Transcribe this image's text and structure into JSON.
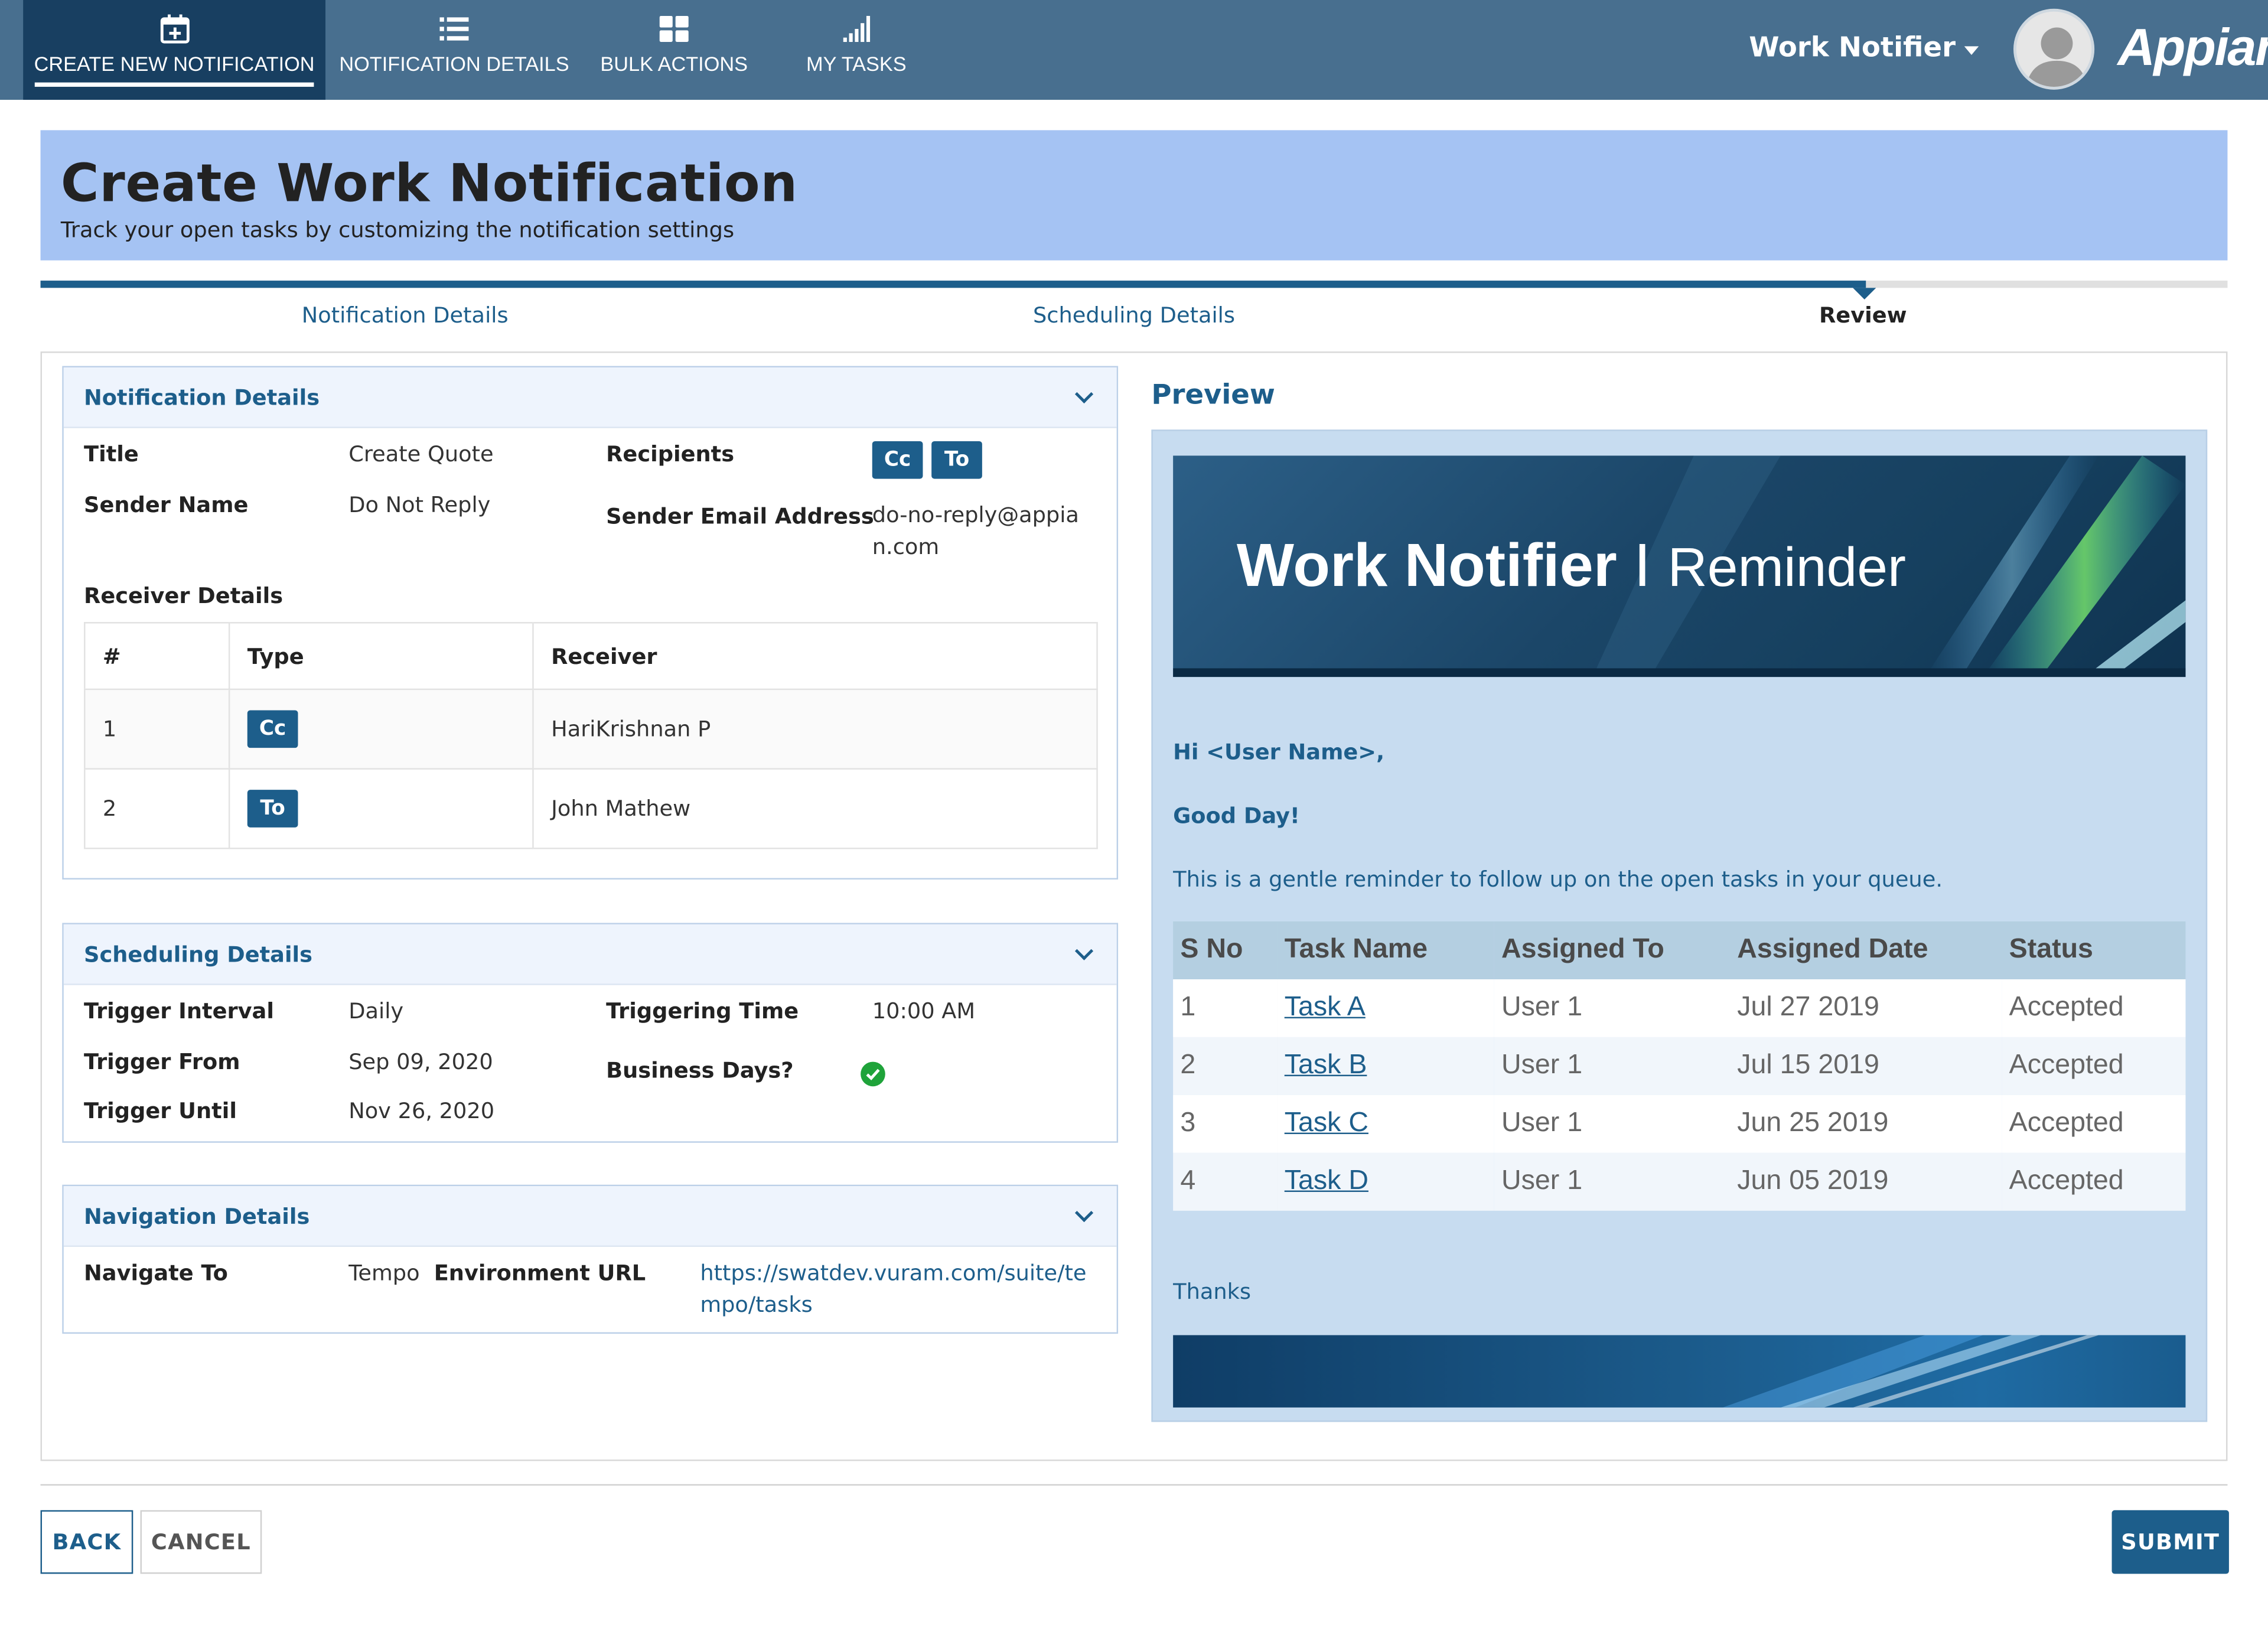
{
  "nav": {
    "tabs": [
      {
        "label": "CREATE NEW NOTIFICATION",
        "icon": "calendar-plus-icon"
      },
      {
        "label": "NOTIFICATION DETAILS",
        "icon": "list-icon"
      },
      {
        "label": "BULK ACTIONS",
        "icon": "grid-icon"
      },
      {
        "label": "MY TASKS",
        "icon": "signal-bars-icon"
      }
    ],
    "app_menu": "Work Notifier",
    "logo": "Appian"
  },
  "header": {
    "title": "Create Work Notification",
    "subtitle": "Track your open tasks by customizing the notification settings"
  },
  "steps": [
    {
      "label": "Notification Details"
    },
    {
      "label": "Scheduling Details"
    },
    {
      "label": "Review"
    }
  ],
  "notification": {
    "section_title": "Notification Details",
    "title_label": "Title",
    "title_value": "Create Quote",
    "sender_name_label": "Sender Name",
    "sender_name_value": "Do Not Reply",
    "recipients_label": "Recipients",
    "recipient_badges": [
      "Cc",
      "To"
    ],
    "sender_email_label": "Sender Email Address",
    "sender_email_value": "do-no-reply@appian.com",
    "receiver_details_label": "Receiver Details",
    "receiver_columns": [
      "#",
      "Type",
      "Receiver"
    ],
    "receivers": [
      {
        "num": "1",
        "type": "Cc",
        "name": "HariKrishnan P"
      },
      {
        "num": "2",
        "type": "To",
        "name": "John Mathew"
      }
    ]
  },
  "scheduling": {
    "section_title": "Scheduling Details",
    "interval_label": "Trigger Interval",
    "interval_value": "Daily",
    "time_label": "Triggering Time",
    "time_value": "10:00 AM",
    "from_label": "Trigger From",
    "from_value": "Sep 09, 2020",
    "business_label": "Business Days?",
    "until_label": "Trigger Until",
    "until_value": "Nov 26, 2020"
  },
  "navigation": {
    "section_title": "Navigation Details",
    "navigate_label": "Navigate To",
    "navigate_value": "Tempo",
    "env_label": "Environment URL",
    "env_value": "https://swatdev.vuram.com/suite/tempo/tasks"
  },
  "preview": {
    "title": "Preview",
    "banner_brand": "Work Notifier",
    "banner_sep": "I",
    "banner_rest": "Reminder",
    "greeting": "Hi <User Name>,",
    "good_day": "Good Day!",
    "body": "This is a gentle reminder to follow up on the open tasks in your queue.",
    "table_columns": [
      "S No",
      "Task Name",
      "Assigned To",
      "Assigned Date",
      "Status"
    ],
    "tasks": [
      {
        "sno": "1",
        "name": "Task A",
        "assigned_to": "User 1",
        "date": "Jul 27 2019",
        "status": "Accepted"
      },
      {
        "sno": "2",
        "name": "Task B",
        "assigned_to": "User 1",
        "date": "Jul 15 2019",
        "status": "Accepted"
      },
      {
        "sno": "3",
        "name": "Task C",
        "assigned_to": "User 1",
        "date": "Jun 25 2019",
        "status": "Accepted"
      },
      {
        "sno": "4",
        "name": "Task D",
        "assigned_to": "User 1",
        "date": "Jun 05 2019",
        "status": "Accepted"
      }
    ],
    "thanks": "Thanks"
  },
  "buttons": {
    "back": "BACK",
    "cancel": "CANCEL",
    "submit": "SUBMIT"
  },
  "colors": {
    "topbar": "#486f8f",
    "active_tab": "#183f61",
    "accent": "#1d5e8b",
    "header_bg": "#a5c3f3",
    "preview_bg": "#c7dcf0",
    "success": "#1fa33a"
  }
}
